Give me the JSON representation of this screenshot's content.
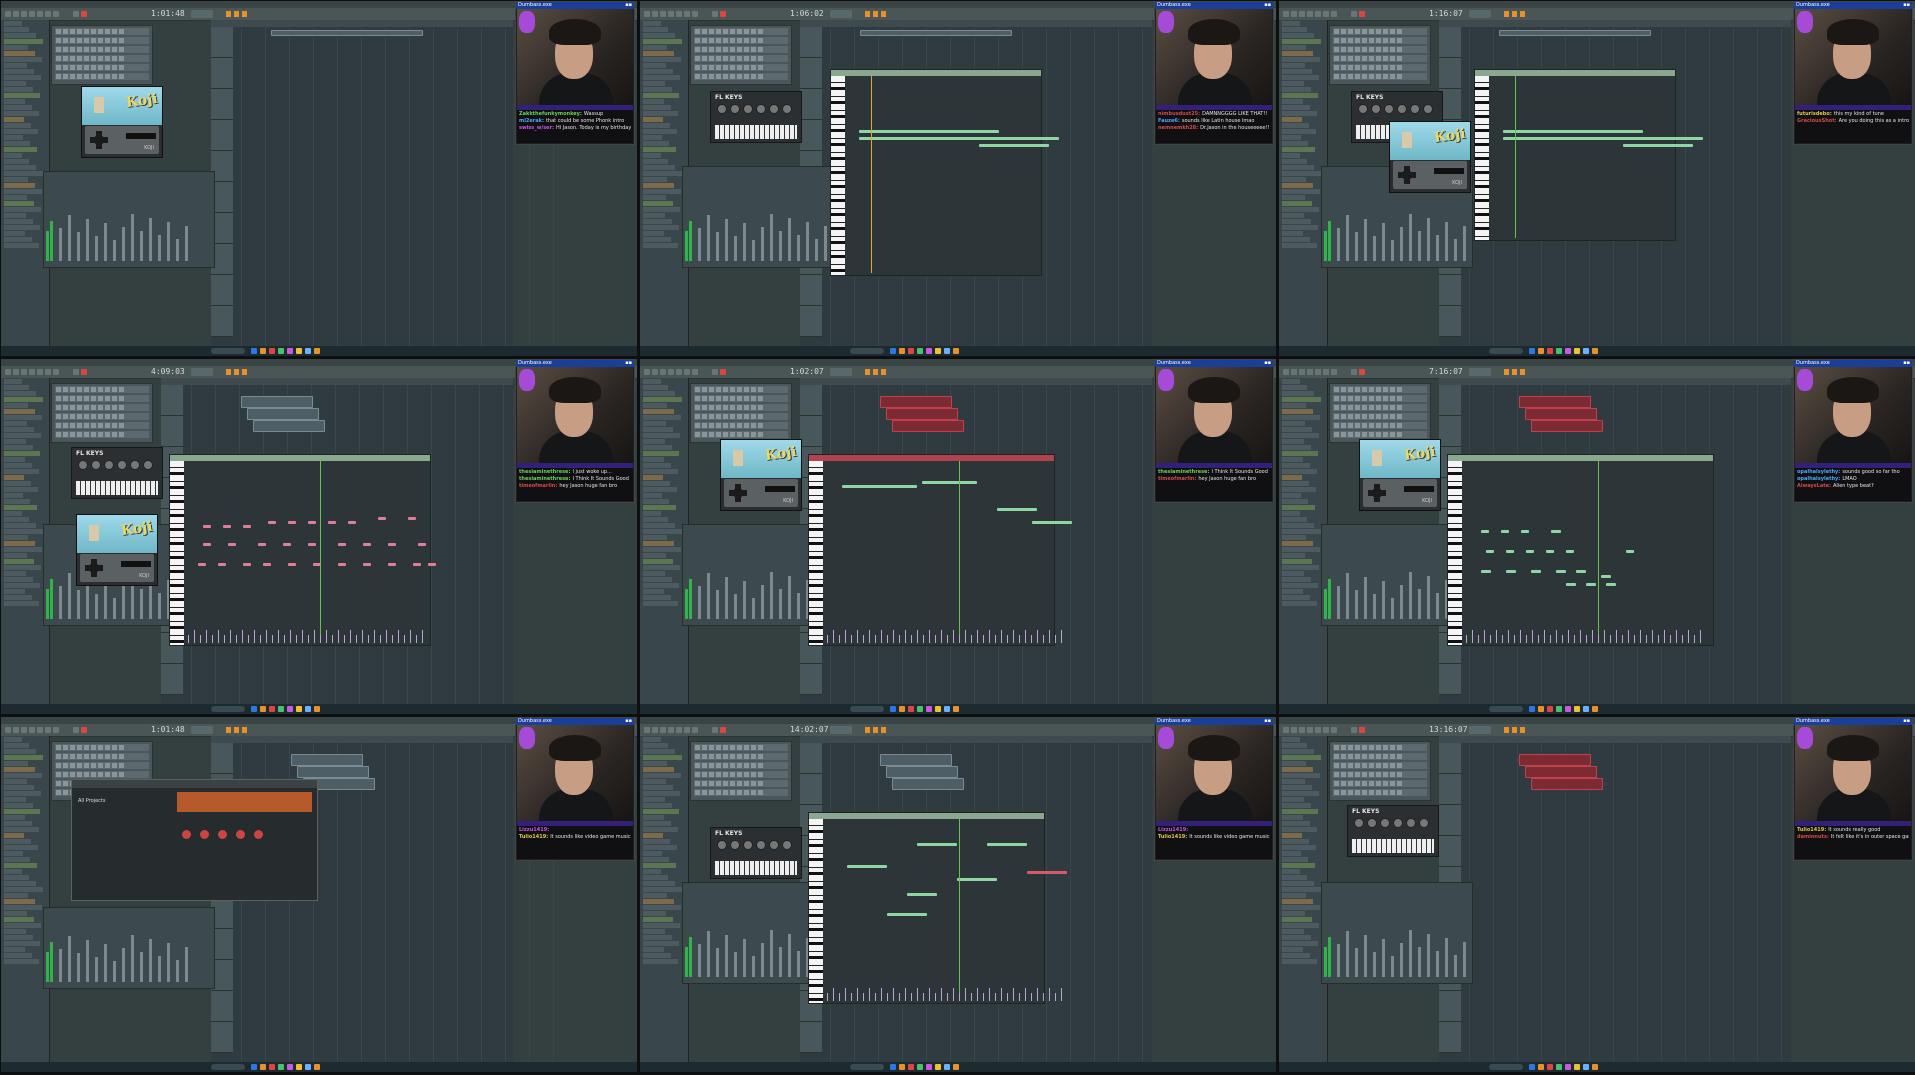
{
  "window_title": "Dumbass.exe",
  "fl_keys_label": "FL KEYS",
  "koji_logo": "Koji",
  "koji_brand": "KOJI",
  "all_projects_label": "All Projects",
  "cells": [
    {
      "time": "1:01:48",
      "chat": [
        {
          "user": "Zakkthefunkymonkey:",
          "text": "Wassup",
          "color": "#6ad15a"
        },
        {
          "user": "mi2erak:",
          "text": "that could be some Phonk intro",
          "color": "#4aa8ff"
        },
        {
          "user": "swiss_w/ser:",
          "text": "Hi Jason. Today is my birthday",
          "color": "#c65ae0"
        }
      ]
    },
    {
      "time": "1:06:02",
      "chat": [
        {
          "user": "nimbusdust25:",
          "text": "DAMNNGGGG LIKE THAT!!",
          "color": "#d04b4b"
        },
        {
          "user": "Fauze6:",
          "text": "sounds like Latin house lmao",
          "color": "#4aa8ff"
        },
        {
          "user": "nemnemkh28:",
          "text": "Dr.Jason in the houseeeee!!!",
          "color": "#d04b4b"
        }
      ]
    },
    {
      "time": "1:16:07",
      "chat": [
        {
          "user": "futurisdebo:",
          "text": "this my kind of tune",
          "color": "#e0c84a"
        },
        {
          "user": "GraciousShot:",
          "text": "Are you doing this as a intro to your videos??",
          "color": "#d04b4b"
        }
      ]
    },
    {
      "time": "4:09:03",
      "chat": [
        {
          "user": "thesiaminethrese:",
          "text": "I just woke up...",
          "color": "#6ad15a"
        },
        {
          "user": "thesiaminethrese:",
          "text": "I Think It Sounds Good",
          "color": "#6ad15a"
        },
        {
          "user": "timeofmarlin:",
          "text": "hey Jason huge fan bro",
          "color": "#d04b4b"
        }
      ]
    },
    {
      "time": "1:02:07",
      "chat": [
        {
          "user": "thesiaminethrese:",
          "text": "I Think It Sounds Good",
          "color": "#6ad15a"
        },
        {
          "user": "timeofmarlin:",
          "text": "hey Jason huge fan bro",
          "color": "#d04b4b"
        }
      ]
    },
    {
      "time": "7:16:07",
      "chat": [
        {
          "user": "opalhalsylethy:",
          "text": "sounds good so far tho",
          "color": "#4aa8ff"
        },
        {
          "user": "opalhalsylethy:",
          "text": "LMAO",
          "color": "#4aa8ff"
        },
        {
          "user": "AlwaysLate:",
          "text": "Alien type beat?",
          "color": "#d04b4b"
        }
      ]
    },
    {
      "time": "1:01:48",
      "chat": [
        {
          "user": "Lizzu1419:",
          "text": "",
          "color": "#c65ae0"
        },
        {
          "user": "Tulio1419:",
          "text": "It sounds like video game music. I like",
          "color": "#e0c84a"
        }
      ]
    },
    {
      "time": "14:02:07",
      "chat": [
        {
          "user": "Lizzu1419:",
          "text": "",
          "color": "#c65ae0"
        },
        {
          "user": "Tulio1419:",
          "text": "It sounds like video game music. I like",
          "color": "#e0c84a"
        }
      ]
    },
    {
      "time": "13:16:07",
      "chat": [
        {
          "user": "Tulio1419:",
          "text": "It sounds really good",
          "color": "#e0c84a"
        },
        {
          "user": "daminnuts:",
          "text": "It felt like it's in outer space game theme",
          "color": "#d04b4b"
        }
      ]
    }
  ]
}
